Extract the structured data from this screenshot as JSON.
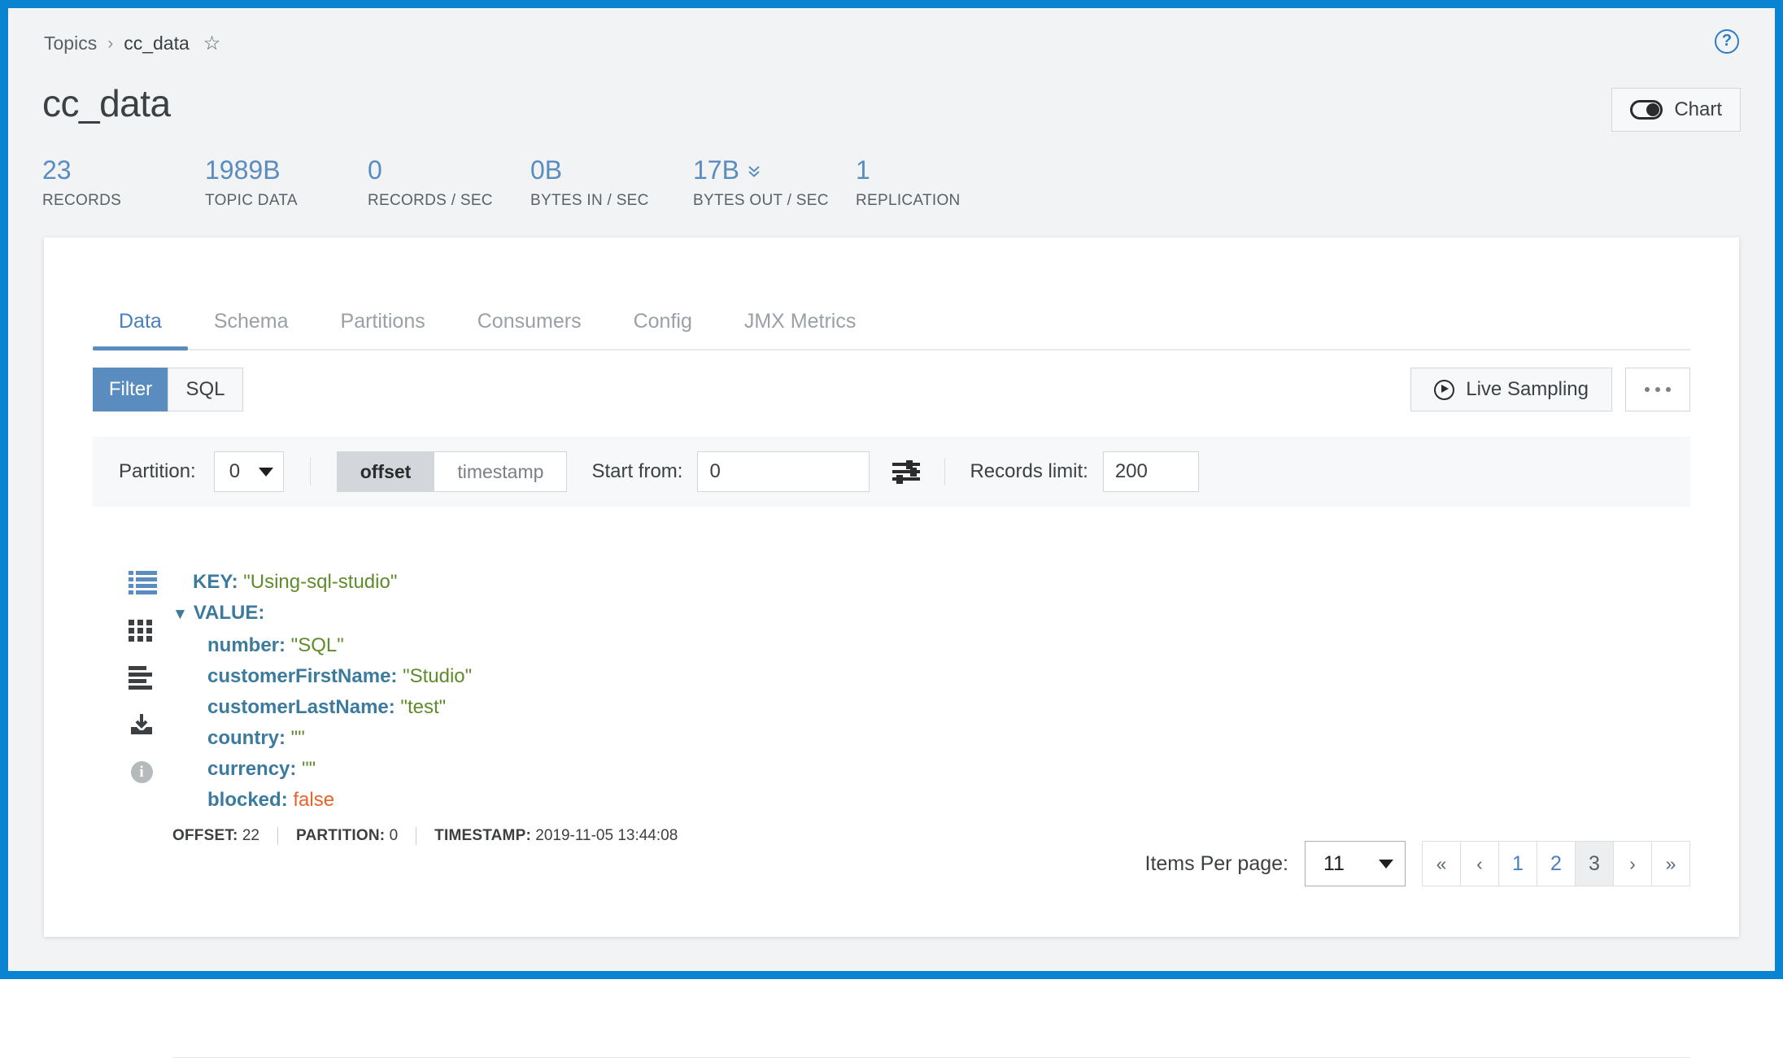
{
  "breadcrumb": {
    "root": "Topics",
    "separator": "›",
    "current": "cc_data",
    "star": "☆"
  },
  "header": {
    "title": "cc_data",
    "help_label": "?",
    "chart_button": "Chart"
  },
  "metrics": [
    {
      "value": "23",
      "label": "RECORDS",
      "chevron": ""
    },
    {
      "value": "1989B",
      "label": "TOPIC DATA",
      "chevron": ""
    },
    {
      "value": "0",
      "label": "RECORDS / SEC",
      "chevron": ""
    },
    {
      "value": "0B",
      "label": "BYTES IN / SEC",
      "chevron": ""
    },
    {
      "value": "17B",
      "label": "BYTES OUT / SEC",
      "chevron": "»"
    },
    {
      "value": "1",
      "label": "REPLICATION",
      "chevron": ""
    }
  ],
  "tabs": [
    {
      "label": "Data",
      "active": true
    },
    {
      "label": "Schema",
      "active": false
    },
    {
      "label": "Partitions",
      "active": false
    },
    {
      "label": "Consumers",
      "active": false
    },
    {
      "label": "Config",
      "active": false
    },
    {
      "label": "JMX Metrics",
      "active": false
    }
  ],
  "toolbar": {
    "mode_filter": "Filter",
    "mode_sql": "SQL",
    "live_sampling": "Live Sampling",
    "more_label": "…"
  },
  "filterbar": {
    "partition_label": "Partition:",
    "partition_value": "0",
    "offset_label": "offset",
    "timestamp_label": "timestamp",
    "start_from_label": "Start from:",
    "start_from_value": "0",
    "start_from_placeholder": "0",
    "records_limit_label": "Records limit:",
    "records_limit_value": "200",
    "records_limit_placeholder": "200"
  },
  "record": {
    "key_label": "KEY:",
    "key_value": "\"Using-sql-studio\"",
    "value_label": "VALUE:",
    "triangle": "▼",
    "fields": [
      {
        "name": "number:",
        "value": "\"SQL\"",
        "type": "string"
      },
      {
        "name": "customerFirstName:",
        "value": "\"Studio\"",
        "type": "string"
      },
      {
        "name": "customerLastName:",
        "value": "\"test\"",
        "type": "string"
      },
      {
        "name": "country:",
        "value": "\"\"",
        "type": "string"
      },
      {
        "name": "currency:",
        "value": "\"\"",
        "type": "string"
      },
      {
        "name": "blocked:",
        "value": "false",
        "type": "boolean"
      }
    ],
    "meta": {
      "offset_label": "OFFSET:",
      "offset_value": "22",
      "partition_label": "PARTITION:",
      "partition_value": "0",
      "timestamp_label": "TIMESTAMP:",
      "timestamp_value": "2019-11-05 13:44:08"
    }
  },
  "pagination": {
    "items_per_page_label": "Items Per page:",
    "items_per_page_value": "11",
    "buttons": [
      {
        "label": "«",
        "kind": "arrow",
        "current": false
      },
      {
        "label": "‹",
        "kind": "arrow",
        "current": false
      },
      {
        "label": "1",
        "kind": "page",
        "current": false
      },
      {
        "label": "2",
        "kind": "page",
        "current": false
      },
      {
        "label": "3",
        "kind": "page",
        "current": true
      },
      {
        "label": "›",
        "kind": "arrow",
        "current": false
      },
      {
        "label": "»",
        "kind": "arrow",
        "current": false
      }
    ]
  },
  "colors": {
    "frame_blue": "#0a84d1",
    "accent_blue": "#5b8cc0",
    "tab_active": "#4a7fbe",
    "json_key": "#3c7a9e",
    "json_string": "#5f8b2a",
    "json_boolean": "#e8622c",
    "page_bg": "#f1f3f4"
  }
}
